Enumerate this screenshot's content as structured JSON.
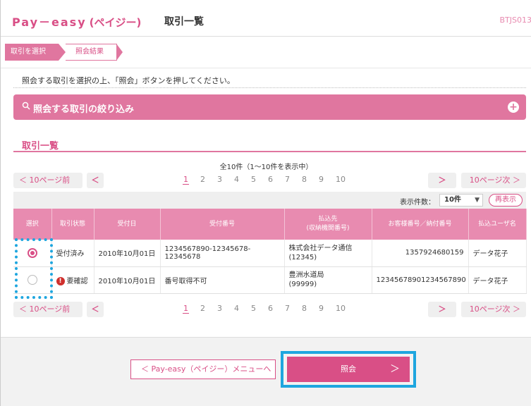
{
  "header": {
    "brand": "Pay－easy",
    "brand_kana": "(ペイジー)",
    "page_title": "取引一覧",
    "screen_id": "BTJS013"
  },
  "steps": [
    {
      "label": "取引を選択",
      "state": "active"
    },
    {
      "label": "照会結果",
      "state": "next"
    }
  ],
  "instruction": "照会する取引を選択の上、「照会」ボタンを押してください。",
  "filter": {
    "title": "照会する取引の絞り込み",
    "icon": "search-icon",
    "expand_icon": "plus-icon"
  },
  "section_title": "取引一覧",
  "summary": "全10件（1〜10件を表示中）",
  "pager": {
    "prev_10": "10ページ前",
    "prev_symbol": "＜",
    "pages": [
      "1",
      "2",
      "3",
      "4",
      "5",
      "6",
      "7",
      "8",
      "9",
      "10"
    ],
    "current_page": "1",
    "next_symbol": "＞",
    "next_10": "10ページ次"
  },
  "display_count": {
    "label": "表示件数：",
    "value": "10件",
    "refresh": "再表示"
  },
  "table": {
    "headers": [
      "選択",
      "取引状態",
      "受付日",
      "受付番号",
      "払込先\n(収納機関番号)",
      "お客様番号／納付番号",
      "払込ユーザ名"
    ],
    "rows": [
      {
        "selected": true,
        "status": "受付済み",
        "warning": false,
        "date": "2010年10月01日",
        "receipt_no": "1234567890-12345678-12345678",
        "payee": "株式会社データ通信\n(12345)",
        "customer_no": "1357924680159",
        "user": "データ花子"
      },
      {
        "selected": false,
        "status": "要確認",
        "warning": true,
        "date": "2010年10月01日",
        "receipt_no": "番号取得不可",
        "payee": "豊洲水道局\n(99999)",
        "customer_no": "12345678901234567890",
        "user": "データ花子"
      }
    ]
  },
  "buttons": {
    "menu": "Pay-easy（ペイジー）メニューへ",
    "inquiry": "照会"
  },
  "colors": {
    "accent": "#d94f86",
    "header_pink": "#e88bb0",
    "highlight": "#1ea6df"
  }
}
